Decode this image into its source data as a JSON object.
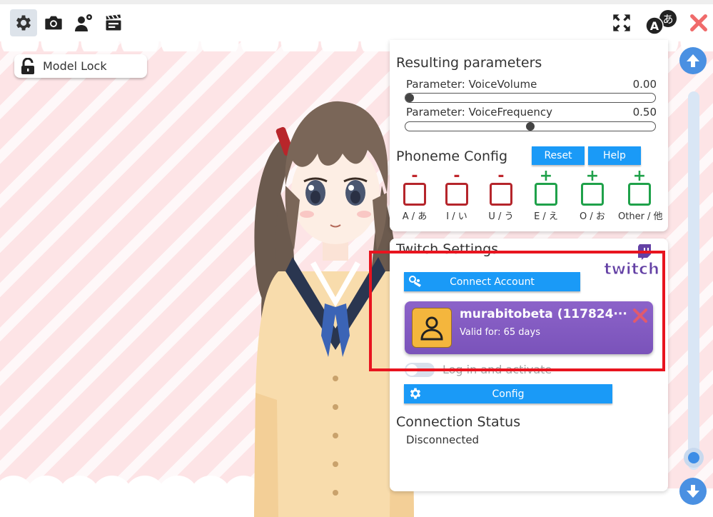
{
  "toolbar": {
    "buttons": [
      "gear-icon",
      "camera-icon",
      "user-settings-icon",
      "clapperboard-icon"
    ],
    "right_buttons": [
      "fullscreen-icon",
      "language-icon",
      "close-icon"
    ],
    "language_glyph_a": "A",
    "language_glyph_jp": "あ",
    "close_color": "#f06b6b"
  },
  "stage": {
    "model_lock_label": "Model Lock"
  },
  "resulting_parameters": {
    "title": "Resulting parameters",
    "params": [
      {
        "label": "Parameter:  VoiceVolume",
        "value": "0.00",
        "level": 0.0
      },
      {
        "label": "Parameter:  VoiceFrequency",
        "value": "0.50",
        "level": 0.5
      }
    ]
  },
  "phoneme_config": {
    "title": "Phoneme Config",
    "reset_label": "Reset",
    "help_label": "Help",
    "items": [
      {
        "mark": "-",
        "label": "A / あ",
        "state": "minus"
      },
      {
        "mark": "-",
        "label": "I / い",
        "state": "minus"
      },
      {
        "mark": "-",
        "label": "U / う",
        "state": "minus"
      },
      {
        "mark": "+",
        "label": "E / え",
        "state": "plus"
      },
      {
        "mark": "+",
        "label": "O / お",
        "state": "plus"
      },
      {
        "mark": "+",
        "label": "Other / 他",
        "state": "plus"
      }
    ]
  },
  "twitch_settings": {
    "title": "Twitch Settings",
    "logo_text": "twitch",
    "connect_label": "Connect Account",
    "account_name": "murabitobeta (117824···",
    "account_valid": "Valid for: 65 days",
    "toggle_label": "Log in and activate",
    "config_label": "Config"
  },
  "connection_status": {
    "title": "Connection Status",
    "value": "Disconnected"
  },
  "colors": {
    "accent_blue": "#1a9af7",
    "twitch_purple": "#7a53ba",
    "highlight_red": "#e8141f"
  }
}
